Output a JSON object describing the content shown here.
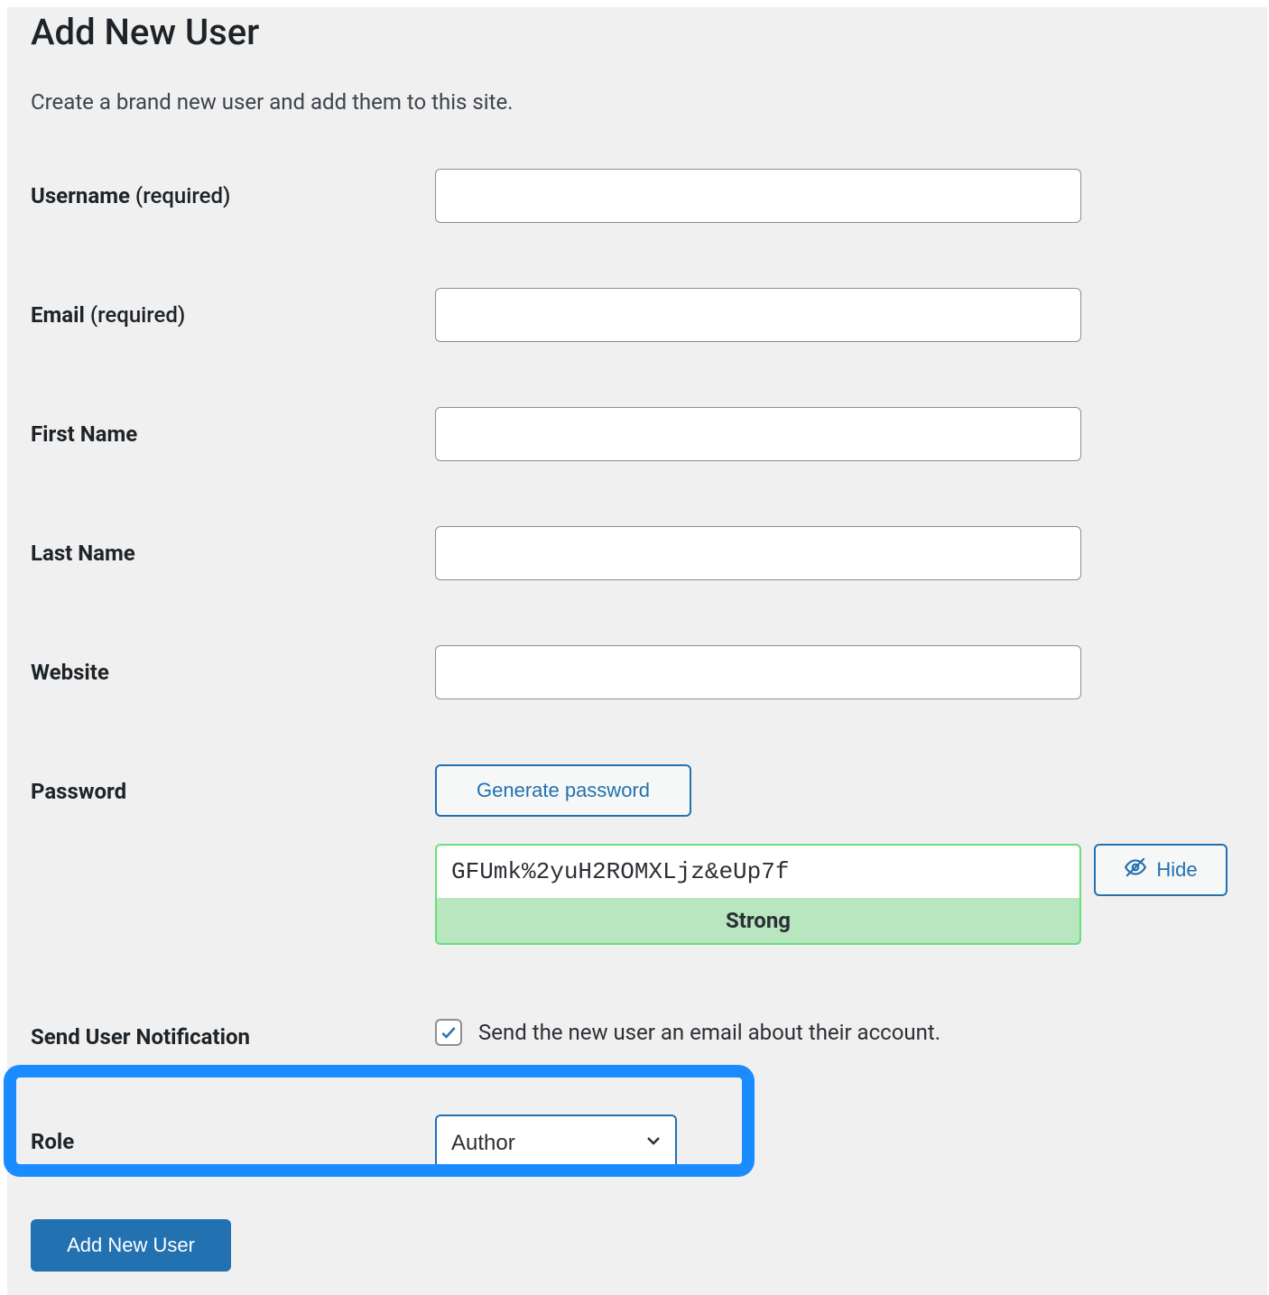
{
  "page": {
    "title": "Add New User",
    "description": "Create a brand new user and add them to this site."
  },
  "form": {
    "username": {
      "label": "Username ",
      "required_suffix": "(required)",
      "value": ""
    },
    "email": {
      "label": "Email ",
      "required_suffix": "(required)",
      "value": ""
    },
    "firstname": {
      "label": "First Name",
      "value": ""
    },
    "lastname": {
      "label": "Last Name",
      "value": ""
    },
    "website": {
      "label": "Website",
      "value": ""
    },
    "password": {
      "label": "Password",
      "generate_button": "Generate password",
      "value": "GFUmk%2yuH2ROMXLjz&eUp7f",
      "strength_label": "Strong",
      "hide_button": "Hide"
    },
    "notification": {
      "label": "Send User Notification",
      "checked": true,
      "text": "Send the new user an email about their account."
    },
    "role": {
      "label": "Role",
      "selected": "Author"
    },
    "submit_button": "Add New User"
  }
}
